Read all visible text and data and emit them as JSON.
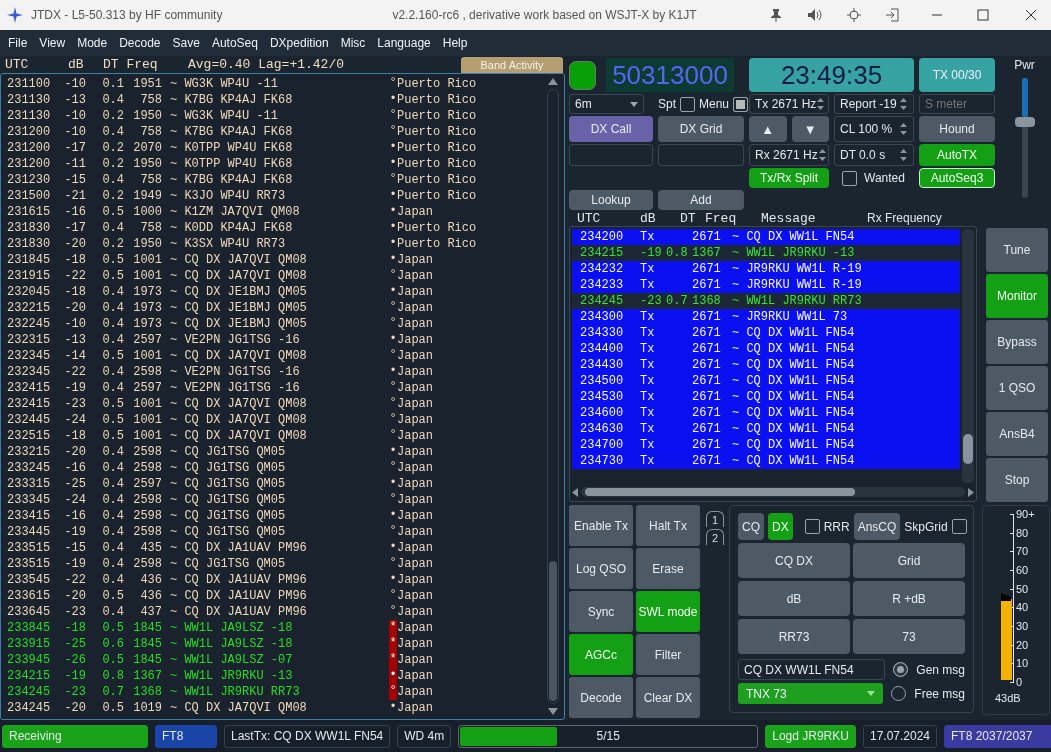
{
  "window": {
    "title": "JTDX - L5-50.313  by HF community",
    "subtitle": "v2.2.160-rc6 , derivative work based on WSJT-X by K1JT"
  },
  "menu": [
    "File",
    "View",
    "Mode",
    "Decode",
    "Save",
    "AutoSeq",
    "DXpedition",
    "Misc",
    "Language",
    "Help"
  ],
  "band_activity": {
    "columns": [
      "UTC",
      "dB",
      "DT Freq"
    ],
    "stats": "Avg=0.40 Lag=+1.42/0",
    "label": "Band Activity",
    "rows": [
      {
        "utc": "231100",
        "db": "-10",
        "dt": "0.1",
        "freq": "1951",
        "message": "~ WG3K WP4U -11",
        "marker": "°",
        "country": "Puerto Rico",
        "kind": "normal"
      },
      {
        "utc": "231130",
        "db": "-13",
        "dt": "0.4",
        "freq": "758",
        "message": "~ K7BG KP4AJ FK68",
        "marker": "•",
        "country": "Puerto Rico",
        "kind": "normal"
      },
      {
        "utc": "231130",
        "db": "-10",
        "dt": "0.2",
        "freq": "1950",
        "message": "~ WG3K WP4U -11",
        "marker": "°",
        "country": "Puerto Rico",
        "kind": "normal"
      },
      {
        "utc": "231200",
        "db": "-10",
        "dt": "0.4",
        "freq": "758",
        "message": "~ K7BG KP4AJ FK68",
        "marker": "°",
        "country": "Puerto Rico",
        "kind": "normal"
      },
      {
        "utc": "231200",
        "db": "-17",
        "dt": "0.2",
        "freq": "2070",
        "message": "~ K0TPP WP4U FK68",
        "marker": "•",
        "country": "Puerto Rico",
        "kind": "normal"
      },
      {
        "utc": "231200",
        "db": "-11",
        "dt": "0.2",
        "freq": "1950",
        "message": "~ K0TPP WP4U FK68",
        "marker": "•",
        "country": "Puerto Rico",
        "kind": "normal"
      },
      {
        "utc": "231230",
        "db": "-15",
        "dt": "0.4",
        "freq": "758",
        "message": "~ K7BG KP4AJ FK68",
        "marker": "°",
        "country": "Puerto Rico",
        "kind": "normal"
      },
      {
        "utc": "231500",
        "db": "-21",
        "dt": "0.2",
        "freq": "1949",
        "message": "~ K3JO WP4U RR73",
        "marker": "•",
        "country": "Puerto Rico",
        "kind": "normal"
      },
      {
        "utc": "231615",
        "db": "-16",
        "dt": "0.5",
        "freq": "1000",
        "message": "~ K1ZM JA7QVI QM08",
        "marker": "•",
        "country": "Japan",
        "kind": "normal"
      },
      {
        "utc": "231830",
        "db": "-17",
        "dt": "0.4",
        "freq": "758",
        "message": "~ K0DD KP4AJ FK68",
        "marker": "•",
        "country": "Puerto Rico",
        "kind": "normal"
      },
      {
        "utc": "231830",
        "db": "-20",
        "dt": "0.2",
        "freq": "1950",
        "message": "~ K3SX WP4U RR73",
        "marker": "•",
        "country": "Puerto Rico",
        "kind": "normal"
      },
      {
        "utc": "231845",
        "db": "-18",
        "dt": "0.5",
        "freq": "1001",
        "message": "~ CQ DX JA7QVI QM08",
        "marker": "•",
        "country": "Japan",
        "kind": "normal"
      },
      {
        "utc": "231915",
        "db": "-22",
        "dt": "0.5",
        "freq": "1001",
        "message": "~ CQ DX JA7QVI QM08",
        "marker": "°",
        "country": "Japan",
        "kind": "normal"
      },
      {
        "utc": "232045",
        "db": "-18",
        "dt": "0.4",
        "freq": "1973",
        "message": "~ CQ DX JE1BMJ QM05",
        "marker": "•",
        "country": "Japan",
        "kind": "normal"
      },
      {
        "utc": "232215",
        "db": "-20",
        "dt": "0.4",
        "freq": "1973",
        "message": "~ CQ DX JE1BMJ QM05",
        "marker": "°",
        "country": "Japan",
        "kind": "normal"
      },
      {
        "utc": "232245",
        "db": "-10",
        "dt": "0.4",
        "freq": "1973",
        "message": "~ CQ DX JE1BMJ QM05",
        "marker": "°",
        "country": "Japan",
        "kind": "normal"
      },
      {
        "utc": "232315",
        "db": "-13",
        "dt": "0.4",
        "freq": "2597",
        "message": "~ VE2PN JG1TSG -16",
        "marker": "•",
        "country": "Japan",
        "kind": "normal"
      },
      {
        "utc": "232345",
        "db": "-14",
        "dt": "0.5",
        "freq": "1001",
        "message": "~ CQ DX JA7QVI QM08",
        "marker": "°",
        "country": "Japan",
        "kind": "normal"
      },
      {
        "utc": "232345",
        "db": "-22",
        "dt": "0.4",
        "freq": "2598",
        "message": "~ VE2PN JG1TSG -16",
        "marker": "•",
        "country": "Japan",
        "kind": "normal"
      },
      {
        "utc": "232415",
        "db": "-19",
        "dt": "0.4",
        "freq": "2597",
        "message": "~ VE2PN JG1TSG -16",
        "marker": "°",
        "country": "Japan",
        "kind": "normal"
      },
      {
        "utc": "232415",
        "db": "-23",
        "dt": "0.5",
        "freq": "1001",
        "message": "~ CQ DX JA7QVI QM08",
        "marker": "°",
        "country": "Japan",
        "kind": "normal"
      },
      {
        "utc": "232445",
        "db": "-24",
        "dt": "0.5",
        "freq": "1001",
        "message": "~ CQ DX JA7QVI QM08",
        "marker": "°",
        "country": "Japan",
        "kind": "normal"
      },
      {
        "utc": "232515",
        "db": "-18",
        "dt": "0.5",
        "freq": "1001",
        "message": "~ CQ DX JA7QVI QM08",
        "marker": "°",
        "country": "Japan",
        "kind": "normal"
      },
      {
        "utc": "233215",
        "db": "-20",
        "dt": "0.4",
        "freq": "2598",
        "message": "~ CQ JG1TSG QM05",
        "marker": "•",
        "country": "Japan",
        "kind": "normal"
      },
      {
        "utc": "233245",
        "db": "-16",
        "dt": "0.4",
        "freq": "2598",
        "message": "~ CQ JG1TSG QM05",
        "marker": "°",
        "country": "Japan",
        "kind": "normal"
      },
      {
        "utc": "233315",
        "db": "-25",
        "dt": "0.4",
        "freq": "2597",
        "message": "~ CQ JG1TSG QM05",
        "marker": "•",
        "country": "Japan",
        "kind": "normal"
      },
      {
        "utc": "233345",
        "db": "-24",
        "dt": "0.4",
        "freq": "2598",
        "message": "~ CQ JG1TSG QM05",
        "marker": "°",
        "country": "Japan",
        "kind": "normal"
      },
      {
        "utc": "233415",
        "db": "-16",
        "dt": "0.4",
        "freq": "2598",
        "message": "~ CQ JG1TSG QM05",
        "marker": "•",
        "country": "Japan",
        "kind": "normal"
      },
      {
        "utc": "233445",
        "db": "-19",
        "dt": "0.4",
        "freq": "2598",
        "message": "~ CQ JG1TSG QM05",
        "marker": "°",
        "country": "Japan",
        "kind": "normal"
      },
      {
        "utc": "233515",
        "db": "-15",
        "dt": "0.4",
        "freq": "435",
        "message": "~ CQ DX JA1UAV PM96",
        "marker": "•",
        "country": "Japan",
        "kind": "normal"
      },
      {
        "utc": "233515",
        "db": "-19",
        "dt": "0.4",
        "freq": "2598",
        "message": "~ CQ JG1TSG QM05",
        "marker": "°",
        "country": "Japan",
        "kind": "normal"
      },
      {
        "utc": "233545",
        "db": "-22",
        "dt": "0.4",
        "freq": "436",
        "message": "~ CQ DX JA1UAV PM96",
        "marker": "•",
        "country": "Japan",
        "kind": "normal"
      },
      {
        "utc": "233615",
        "db": "-20",
        "dt": "0.5",
        "freq": "436",
        "message": "~ CQ DX JA1UAV PM96",
        "marker": "°",
        "country": "Japan",
        "kind": "normal"
      },
      {
        "utc": "233645",
        "db": "-23",
        "dt": "0.4",
        "freq": "437",
        "message": "~ CQ DX JA1UAV PM96",
        "marker": "°",
        "country": "Japan",
        "kind": "normal"
      },
      {
        "utc": "233845",
        "db": "-18",
        "dt": "0.5",
        "freq": "1845",
        "message": "~ WW1L JA9LSZ -18",
        "marker": "*",
        "country": "Japan",
        "kind": "mine"
      },
      {
        "utc": "233915",
        "db": "-25",
        "dt": "0.6",
        "freq": "1845",
        "message": "~ WW1L JA9LSZ -18",
        "marker": "*",
        "country": "Japan",
        "kind": "mine"
      },
      {
        "utc": "233945",
        "db": "-26",
        "dt": "0.5",
        "freq": "1845",
        "message": "~ WW1L JA9LSZ -07",
        "marker": "*",
        "country": "Japan",
        "kind": "mine"
      },
      {
        "utc": "234215",
        "db": "-19",
        "dt": "0.8",
        "freq": "1367",
        "message": "~ WW1L JR9RKU -13",
        "marker": "•",
        "country": "Japan",
        "kind": "mine"
      },
      {
        "utc": "234245",
        "db": "-23",
        "dt": "0.7",
        "freq": "1368",
        "message": "~ WW1L JR9RKU RR73",
        "marker": "°",
        "country": "Japan",
        "kind": "mine"
      },
      {
        "utc": "234245",
        "db": "-20",
        "dt": "0.5",
        "freq": "1019",
        "message": "~ CQ DX JA7QVI QM08",
        "marker": "•",
        "country": "Japan",
        "kind": "normal"
      }
    ]
  },
  "dial": {
    "led_on": true,
    "frequency": "50313000",
    "clock": "23:49:35",
    "tx_counter": "TX 00/30",
    "power_label": "Pwr",
    "power": {
      "level": 0.65
    }
  },
  "controls": {
    "band": "6m",
    "spot": {
      "label": "Spt",
      "checked": false
    },
    "menu_toggle": {
      "label": "Menu",
      "checked": true
    },
    "dx_call": "DX Call",
    "dx_grid": "DX Grid",
    "lookup": "Lookup",
    "add": "Add",
    "tx_freq": "Tx  2671 Hz",
    "rx_freq": "Rx  2671 Hz",
    "up": "▲",
    "down": "▼",
    "split": {
      "label": "Tx/Rx Split",
      "on": true
    },
    "report": "Report -19",
    "cl": "CL  100 %",
    "dt": "DT 0.0 s",
    "wanted": {
      "label": "Wanted",
      "checked": false
    },
    "s_meter": {
      "placeholder": "S meter"
    },
    "hound": {
      "label": "Hound",
      "on": false
    },
    "autotx": {
      "label": "AutoTX",
      "on": true
    },
    "autoseq": {
      "label": "AutoSeq3",
      "on": true
    }
  },
  "rx_frequency": {
    "columns": [
      "UTC",
      "dB",
      "DT",
      "Freq",
      "Message"
    ],
    "title": "Rx Frequency",
    "rows": [
      {
        "utc": "234200",
        "db": "Tx",
        "freq": "2671",
        "message": "~ CQ DX WW1L FN54",
        "kind": "tx"
      },
      {
        "utc": "234215",
        "db": "-19",
        "dt": "0.8",
        "freq": "1367",
        "message": "~ WW1L JR9RKU -13",
        "kind": "rx"
      },
      {
        "utc": "234232",
        "db": "Tx",
        "freq": "2671",
        "message": "~ JR9RKU WW1L R-19",
        "kind": "tx"
      },
      {
        "utc": "234233",
        "db": "Tx",
        "freq": "2671",
        "message": "~ JR9RKU WW1L R-19",
        "kind": "tx"
      },
      {
        "utc": "234245",
        "db": "-23",
        "dt": "0.7",
        "freq": "1368",
        "message": "~ WW1L JR9RKU RR73",
        "kind": "rx"
      },
      {
        "utc": "234300",
        "db": "Tx",
        "freq": "2671",
        "message": "~ JR9RKU WW1L 73",
        "kind": "tx"
      },
      {
        "utc": "234330",
        "db": "Tx",
        "freq": "2671",
        "message": "~ CQ DX WW1L FN54",
        "kind": "tx"
      },
      {
        "utc": "234400",
        "db": "Tx",
        "freq": "2671",
        "message": "~ CQ DX WW1L FN54",
        "kind": "tx"
      },
      {
        "utc": "234430",
        "db": "Tx",
        "freq": "2671",
        "message": "~ CQ DX WW1L FN54",
        "kind": "tx"
      },
      {
        "utc": "234500",
        "db": "Tx",
        "freq": "2671",
        "message": "~ CQ DX WW1L FN54",
        "kind": "tx"
      },
      {
        "utc": "234530",
        "db": "Tx",
        "freq": "2671",
        "message": "~ CQ DX WW1L FN54",
        "kind": "tx"
      },
      {
        "utc": "234600",
        "db": "Tx",
        "freq": "2671",
        "message": "~ CQ DX WW1L FN54",
        "kind": "tx"
      },
      {
        "utc": "234630",
        "db": "Tx",
        "freq": "2671",
        "message": "~ CQ DX WW1L FN54",
        "kind": "tx"
      },
      {
        "utc": "234700",
        "db": "Tx",
        "freq": "2671",
        "message": "~ CQ DX WW1L FN54",
        "kind": "tx"
      },
      {
        "utc": "234730",
        "db": "Tx",
        "freq": "2671",
        "message": "~ CQ DX WW1L FN54",
        "kind": "tx"
      }
    ]
  },
  "side_buttons": [
    {
      "label": "Tune",
      "on": false
    },
    {
      "label": "Monitor",
      "on": true
    },
    {
      "label": "Bypass",
      "on": false
    },
    {
      "label": "1 QSO",
      "on": false
    },
    {
      "label": "AnsB4",
      "on": false
    },
    {
      "label": "Stop",
      "on": false
    }
  ],
  "control_buttons": [
    {
      "label": "Enable Tx",
      "on": false
    },
    {
      "label": "Halt Tx",
      "on": false
    },
    {
      "label": "Log QSO",
      "on": false
    },
    {
      "label": "Erase",
      "on": false
    },
    {
      "label": "Sync",
      "on": false
    },
    {
      "label": "SWL mode",
      "on": true
    },
    {
      "label": "AGCc",
      "on": true
    },
    {
      "label": "Filter",
      "on": false
    },
    {
      "label": "Decode",
      "on": false
    },
    {
      "label": "Clear DX",
      "on": false
    }
  ],
  "tabs": [
    "1",
    "2"
  ],
  "tx_panel": {
    "cq": {
      "label": "CQ",
      "on": false
    },
    "dx": {
      "label": "DX",
      "on": true
    },
    "rrr": {
      "label": "RRR",
      "checked": false
    },
    "ans_cq": {
      "label": "AnsCQ",
      "on": false
    },
    "skip_grid": {
      "label": "SkpGrid",
      "checked": false
    },
    "messages": [
      "CQ DX",
      "Grid",
      "dB",
      "R +dB",
      "RR73",
      "73"
    ],
    "gen_message": "CQ DX WW1L FN54",
    "free_message": "TNX 73",
    "modes": [
      {
        "label": "Gen msg",
        "selected": true
      },
      {
        "label": "Free msg",
        "selected": false
      }
    ]
  },
  "meter": {
    "scale": [
      "90+",
      "80",
      "70",
      "60",
      "50",
      "40",
      "30",
      "20",
      "10",
      "0"
    ],
    "level": 0.48,
    "reading": "43dB"
  },
  "status": [
    {
      "kind": "text",
      "text": "Receiving",
      "color": "#1aa31a"
    },
    {
      "kind": "text",
      "text": "FT8",
      "color": "#1a45a8"
    },
    {
      "kind": "text",
      "text": "LastTx: CQ DX WW1L FN54"
    },
    {
      "kind": "text",
      "text": "WD 4m"
    },
    {
      "kind": "progress",
      "text": "5/15",
      "level": 0.33
    },
    {
      "kind": "text",
      "text": "Logd JR9RKU",
      "color": "#1aa31a"
    },
    {
      "kind": "text",
      "text": "17.07.2024"
    },
    {
      "kind": "text",
      "text": "FT8  2037/2037",
      "color": "#3a3aa0"
    }
  ]
}
